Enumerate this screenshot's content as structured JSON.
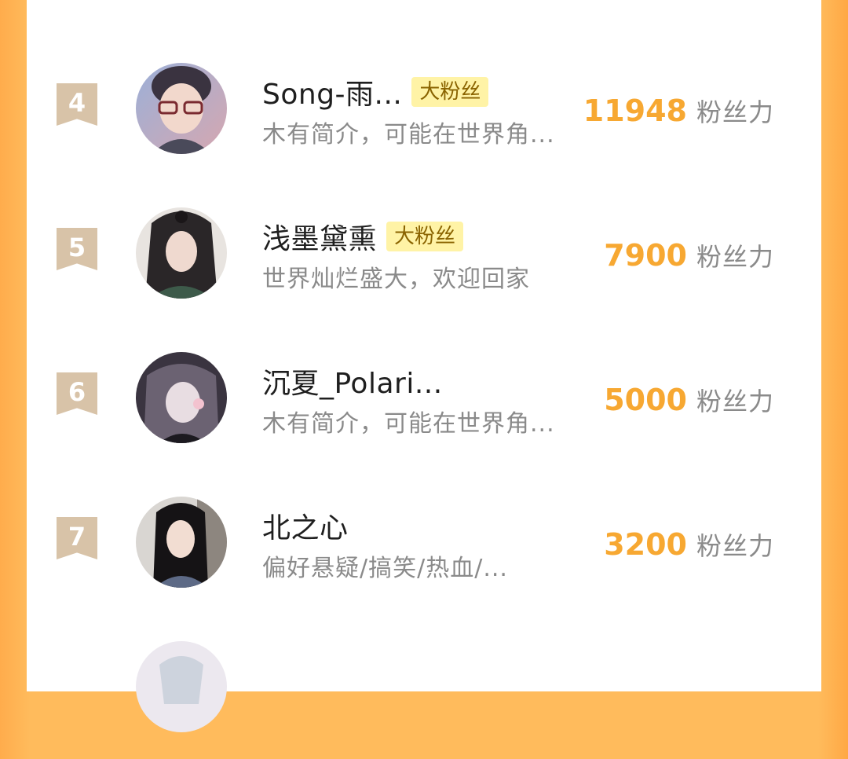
{
  "rows": [
    {
      "rank": "4",
      "name": "Song-雨...",
      "badge": "大粉丝",
      "desc": "木有简介，可能在世界角...",
      "score": "11948",
      "score_label": "粉丝力"
    },
    {
      "rank": "5",
      "name": "浅墨黛熏",
      "badge": "大粉丝",
      "desc": "世界灿烂盛大，欢迎回家",
      "score": "7900",
      "score_label": "粉丝力"
    },
    {
      "rank": "6",
      "name": "沉夏_Polari...",
      "badge": "",
      "desc": "木有简介，可能在世界角...",
      "score": "5000",
      "score_label": "粉丝力"
    },
    {
      "rank": "7",
      "name": "北之心",
      "badge": "",
      "desc": "偏好悬疑/搞笑/热血/...",
      "score": "3200",
      "score_label": "粉丝力"
    }
  ],
  "colors": {
    "accent": "#f7a832",
    "background": "#ffbb5c",
    "badge_bg": "#fff3a6",
    "rank_badge": "#d8c3a8"
  }
}
